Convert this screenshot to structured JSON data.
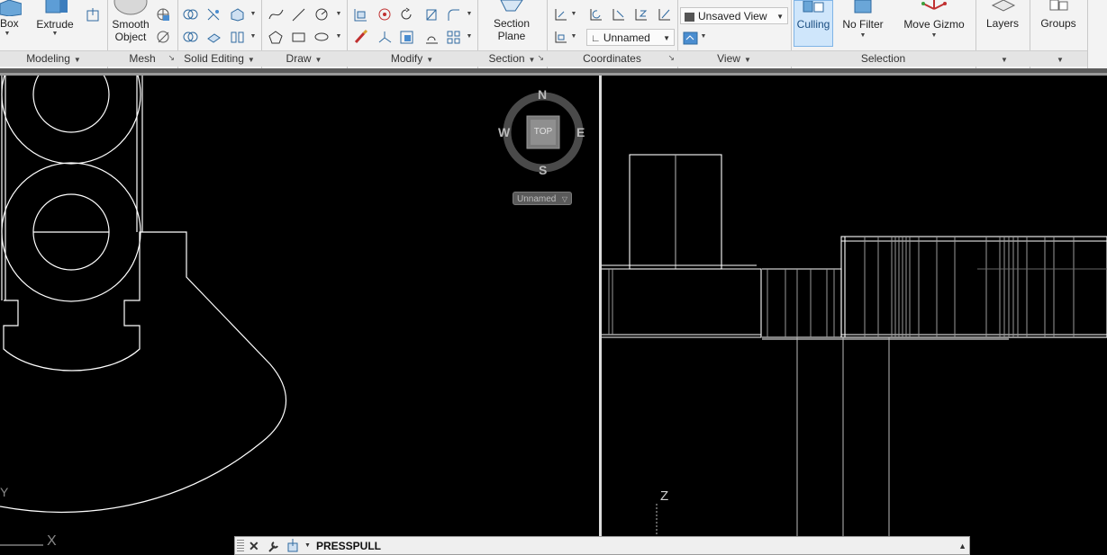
{
  "ribbon": {
    "panels": {
      "modeling": "Modeling",
      "mesh": "Mesh",
      "solid_editing": "Solid Editing",
      "draw": "Draw",
      "modify": "Modify",
      "section": "Section",
      "coordinates": "Coordinates",
      "view": "View",
      "selection": "Selection"
    },
    "buttons": {
      "box": "Box",
      "extrude": "Extrude",
      "smooth_object_line1": "Smooth",
      "smooth_object_line2": "Object",
      "section_plane_line1": "Section",
      "section_plane_line2": "Plane",
      "culling": "Culling",
      "no_filter": "No Filter",
      "move_gizmo": "Move Gizmo",
      "layers": "Layers",
      "groups": "Groups"
    },
    "combos": {
      "view": "Unsaved View",
      "ucs": "Unnamed"
    }
  },
  "viewcube": {
    "north": "N",
    "south": "S",
    "east": "E",
    "west": "W",
    "face": "TOP",
    "ucs_label": "Unnamed"
  },
  "viewport": {
    "ucs_y": "Y",
    "ucs_x": "X",
    "ucs_z": "Z"
  },
  "command_line": {
    "current_command": "PRESSPULL"
  },
  "colors": {
    "ribbon_bg": "#f3f3f3",
    "panel_title_bg": "#e4e4e4",
    "viewport_bg": "#000000",
    "wire": "#ffffff",
    "culling_active": "#cfe6fb"
  }
}
